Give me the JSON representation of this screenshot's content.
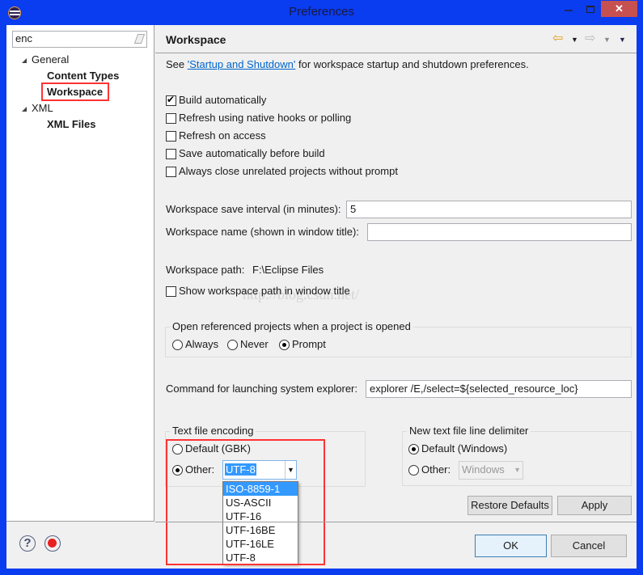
{
  "window": {
    "title": "Preferences",
    "close": "✕",
    "minimize": "—",
    "maximize": "☐"
  },
  "sidebar": {
    "filter_value": "enc",
    "tree": [
      {
        "label": "General",
        "children": [
          "Content Types",
          "Workspace"
        ]
      },
      {
        "label": "XML",
        "children": [
          "XML Files"
        ]
      }
    ],
    "selected": "Workspace"
  },
  "page": {
    "title": "Workspace",
    "intro_prefix": "See ",
    "intro_link": "'Startup and Shutdown'",
    "intro_suffix": " for workspace startup and shutdown preferences.",
    "checkboxes": [
      {
        "label": "Build automatically",
        "checked": true
      },
      {
        "label": "Refresh using native hooks or polling",
        "checked": false
      },
      {
        "label": "Refresh on access",
        "checked": false
      },
      {
        "label": "Save automatically before build",
        "checked": false
      },
      {
        "label": "Always close unrelated projects without prompt",
        "checked": false
      }
    ],
    "save_interval_label": "Workspace save interval (in minutes):",
    "save_interval_value": "5",
    "ws_name_label": "Workspace name (shown in window title):",
    "ws_name_value": "",
    "ws_path_label": "Workspace path:",
    "ws_path_value": "F:\\Eclipse Files",
    "show_path_label": "Show workspace path in window title",
    "show_path_checked": false,
    "open_ref": {
      "legend": "Open referenced projects when a project is opened",
      "options": [
        "Always",
        "Never",
        "Prompt"
      ],
      "selected": "Prompt"
    },
    "cmd_label": "Command for launching system explorer:",
    "cmd_value": "explorer /E,/select=${selected_resource_loc}",
    "encoding": {
      "legend": "Text file encoding",
      "default_label": "Default (GBK)",
      "other_label": "Other:",
      "selected": "Other",
      "value": "UTF-8",
      "options": [
        "ISO-8859-1",
        "US-ASCII",
        "UTF-16",
        "UTF-16BE",
        "UTF-16LE",
        "UTF-8"
      ],
      "highlighted": "ISO-8859-1"
    },
    "delimiter": {
      "legend": "New text file line delimiter",
      "default_label": "Default (Windows)",
      "other_label": "Other:",
      "selected": "Default",
      "value": "Windows"
    },
    "restore_label": "Restore Defaults",
    "apply_label": "Apply"
  },
  "footer": {
    "ok_label": "OK",
    "cancel_label": "Cancel"
  },
  "watermark": "http://blog.csdn.net/",
  "colors": {
    "titlebar": "#0a3cf0",
    "close": "#c75050",
    "highlight": "#3399ff",
    "annotation": "#ff3333",
    "link": "#0066cc"
  }
}
